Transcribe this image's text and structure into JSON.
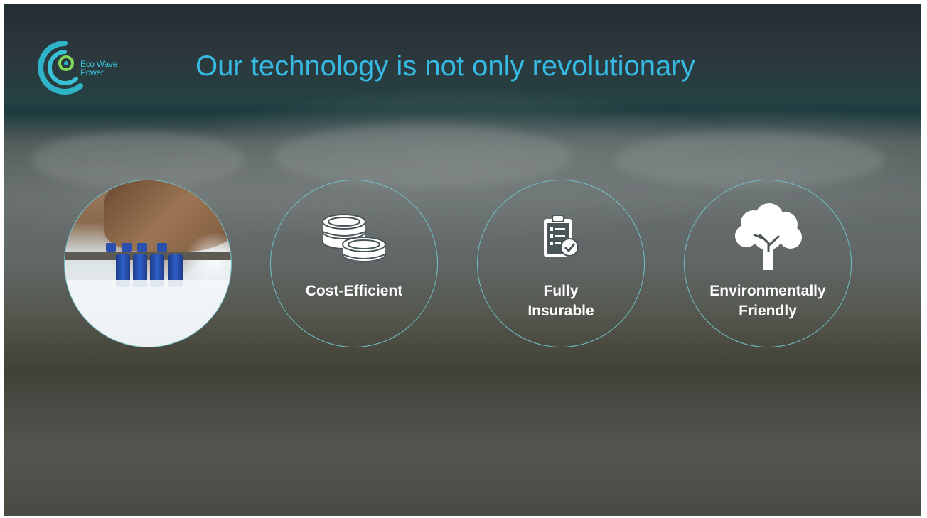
{
  "slide": {
    "title": "Our technology is not only revolutionary",
    "logo": {
      "line1": "Eco Wave",
      "line2": "Power",
      "color": "#3bc0d8"
    },
    "title_color": "#36b9e2",
    "circle_border_color": "#6fc0c8",
    "features": [
      {
        "icon": "coins-icon",
        "line1": "Cost-Efficient",
        "line2": ""
      },
      {
        "icon": "clipboard-check-icon",
        "line1": "Fully",
        "line2": "Insurable"
      },
      {
        "icon": "tree-icon",
        "line1": "Environmentally",
        "line2": "Friendly"
      }
    ]
  }
}
